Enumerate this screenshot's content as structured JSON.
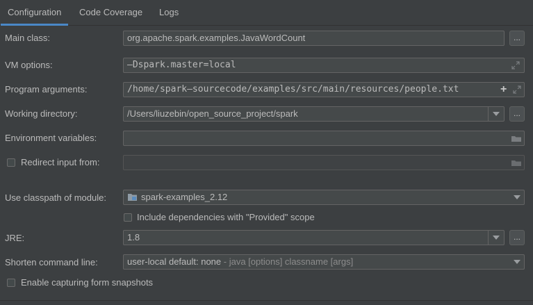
{
  "tabs": [
    {
      "label": "Configuration",
      "active": true
    },
    {
      "label": "Code Coverage",
      "active": false
    },
    {
      "label": "Logs",
      "active": false
    }
  ],
  "form": {
    "main_class": {
      "label": "Main class:",
      "value": "org.apache.spark.examples.JavaWordCount",
      "button": "..."
    },
    "vm_options": {
      "label": "VM options:",
      "value": "–Dspark.master=local"
    },
    "program_arguments": {
      "label": "Program arguments:",
      "value": "/home/spark–sourcecode/examples/src/main/resources/people.txt",
      "add_icon": "+"
    },
    "working_directory": {
      "label": "Working directory:",
      "value": "/Users/liuzebin/open_source_project/spark",
      "button": "..."
    },
    "environment_variables": {
      "label": "Environment variables:",
      "value": ""
    },
    "redirect_input": {
      "label": "Redirect input from:",
      "checked": false,
      "value": ""
    },
    "classpath_module": {
      "label": "Use classpath of module:",
      "value": "spark-examples_2.12"
    },
    "include_provided": {
      "label": "Include dependencies with \"Provided\" scope",
      "checked": false
    },
    "jre": {
      "label": "JRE:",
      "value": "1.8",
      "button": "..."
    },
    "shorten_command_line": {
      "label": "Shorten command line:",
      "value": "user-local default: none",
      "hint": " - java [options] classname [args]"
    },
    "capture_snapshots": {
      "label": "Enable capturing form snapshots",
      "checked": false
    }
  },
  "colors": {
    "background": "#3c3f41",
    "field_background": "#45494a",
    "accent": "#4a88c7",
    "text": "#bbbbbb"
  },
  "icons": [
    "expand-icon",
    "plus-icon",
    "folder-icon",
    "module-folder-icon",
    "dropdown-arrow-icon"
  ]
}
